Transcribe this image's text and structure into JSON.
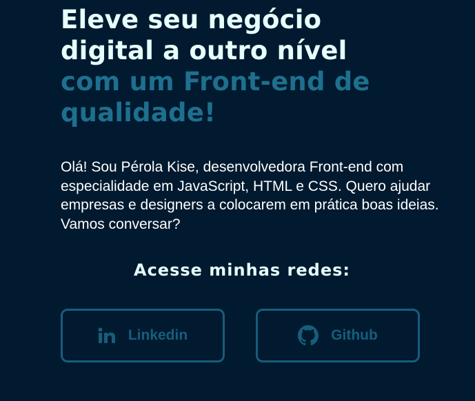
{
  "hero": {
    "line1": "Eleve seu negócio",
    "line2": "digital a outro nível",
    "line3": "com um Front-end de",
    "line4": "qualidade!",
    "intro": "Olá! Sou Pérola Kise, desenvolvedora Front-end com especialidade em JavaScript, HTML e CSS. Quero ajudar empresas e designers a colocarem em prática boas ideias. Vamos conversar?"
  },
  "social": {
    "title": "Acesse minhas redes:",
    "linkedin": {
      "label": "Linkedin",
      "icon": "linkedin-icon"
    },
    "github": {
      "label": "Github",
      "icon": "github-icon"
    }
  },
  "colors": {
    "background": "#011a2f",
    "headline_light": "#e6fffc",
    "headline_accent": "#1f6f8e",
    "button_accent": "#165e7c"
  }
}
